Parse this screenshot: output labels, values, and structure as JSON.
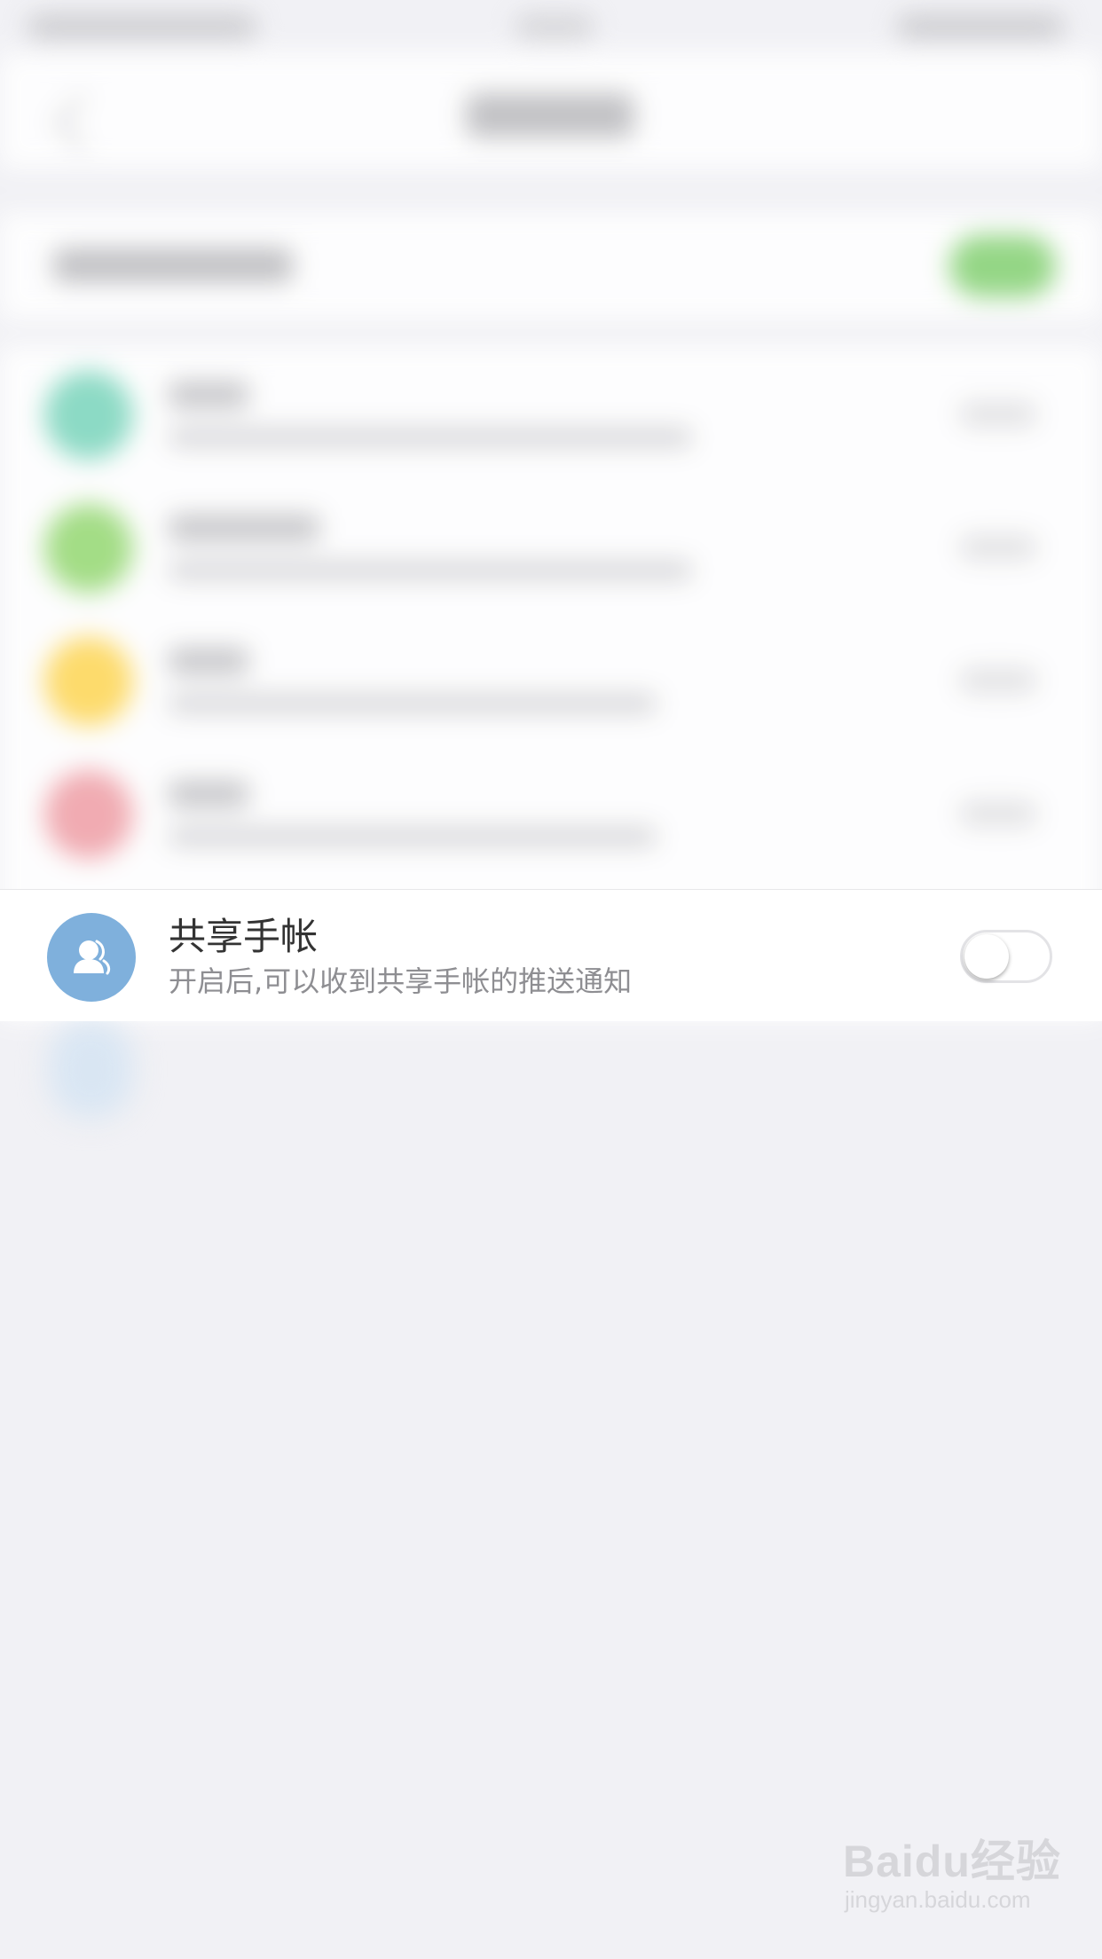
{
  "share_row": {
    "icon": "person-icon",
    "title": "共享手帐",
    "subtitle": "开启后,可以收到共享手帐的推送通知",
    "toggle_state": "off",
    "avatar_color": "#7fb0dc"
  },
  "blurred_items": [
    {
      "avatar_color": "#82d8c0"
    },
    {
      "avatar_color": "#9bdb7a"
    },
    {
      "avatar_color": "#ffd95e"
    },
    {
      "avatar_color": "#f1a4ab"
    }
  ],
  "colors": {
    "background": "#f1f1f5",
    "toggle_on_blurred": "#8bd47a"
  },
  "watermark": {
    "logo": "Baidu经验",
    "url": "jingyan.baidu.com"
  }
}
